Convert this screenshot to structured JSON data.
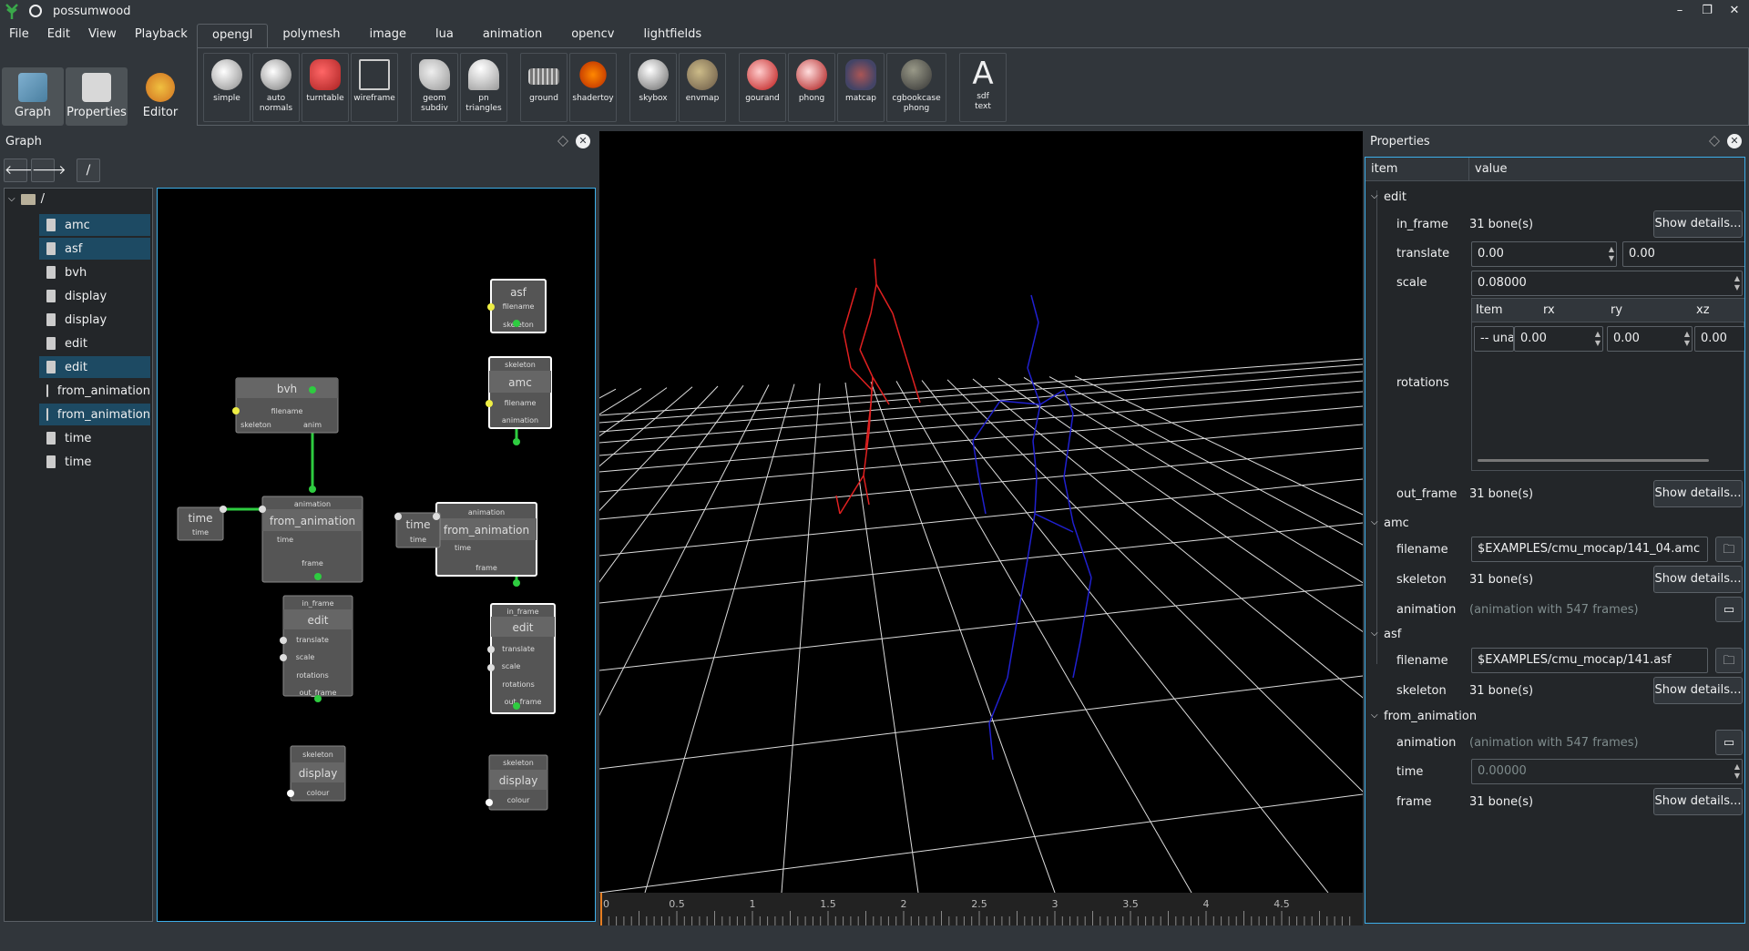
{
  "window": {
    "title": "possumwood",
    "controls": [
      "–",
      "❐",
      "✕"
    ]
  },
  "menus": [
    "File",
    "Edit",
    "View",
    "Playback"
  ],
  "modes": [
    {
      "label": "Graph",
      "active": true
    },
    {
      "label": "Properties",
      "active": true
    },
    {
      "label": "Editor",
      "active": false
    }
  ],
  "tabs": [
    "opengl",
    "polymesh",
    "image",
    "lua",
    "animation",
    "opencv",
    "lightfields"
  ],
  "active_tab": "opengl",
  "tools": [
    {
      "label": "simple",
      "icon": "teapot-icon"
    },
    {
      "label": "auto\nnormals",
      "icon": "teapot-icon"
    },
    {
      "label": "turntable",
      "icon": "car-icon"
    },
    {
      "label": "wireframe",
      "icon": "cube-wire-icon"
    },
    {
      "label": "geom\nsubdiv",
      "icon": "shape-icon"
    },
    {
      "label": "pn\ntriangles",
      "icon": "cone-icon"
    },
    {
      "label": "ground",
      "icon": "plane-icon"
    },
    {
      "label": "shadertoy",
      "icon": "swirl-icon"
    },
    {
      "label": "skybox",
      "icon": "sphere-icon"
    },
    {
      "label": "envmap",
      "icon": "teapot-gold-icon"
    },
    {
      "label": "gourand",
      "icon": "teapot-red-icon"
    },
    {
      "label": "phong",
      "icon": "teapot-red-icon"
    },
    {
      "label": "matcap",
      "icon": "figure-icon"
    },
    {
      "label": "cgbookcase\nphong",
      "icon": "sphere-dark-icon"
    },
    {
      "label": "sdf\ntext",
      "icon": "letter-a-icon"
    }
  ],
  "graph_dock": {
    "title": "Graph",
    "path": "/"
  },
  "tree": {
    "root": "/",
    "items": [
      {
        "label": "amc",
        "selected": true
      },
      {
        "label": "asf",
        "selected": true
      },
      {
        "label": "bvh",
        "selected": false
      },
      {
        "label": "display",
        "selected": false
      },
      {
        "label": "display",
        "selected": false
      },
      {
        "label": "edit",
        "selected": false
      },
      {
        "label": "edit",
        "selected": true
      },
      {
        "label": "from_animation",
        "selected": false
      },
      {
        "label": "from_animation",
        "selected": true
      },
      {
        "label": "time",
        "selected": false
      },
      {
        "label": "time",
        "selected": false
      }
    ]
  },
  "nodes": {
    "bvh": {
      "title": "bvh",
      "ports": [
        "filename",
        "skeleton",
        "anim"
      ]
    },
    "from_anim_l": {
      "title": "from_animation",
      "ports": [
        "animation",
        "time",
        "frame"
      ]
    },
    "time_l": {
      "title": "time",
      "ports": [
        "time"
      ]
    },
    "edit_l": {
      "title": "edit",
      "ports": [
        "in_frame",
        "translate",
        "scale",
        "rotations",
        "out_frame"
      ]
    },
    "display_l": {
      "title": "display",
      "ports": [
        "skeleton",
        "colour"
      ]
    },
    "asf": {
      "title": "asf",
      "ports": [
        "filename",
        "skeleton"
      ]
    },
    "amc": {
      "title": "amc",
      "ports": [
        "skeleton",
        "filename",
        "animation"
      ]
    },
    "from_anim_r": {
      "title": "from_animation",
      "ports": [
        "animation",
        "time",
        "frame"
      ]
    },
    "time_r": {
      "title": "time",
      "ports": [
        "time"
      ]
    },
    "edit_r": {
      "title": "edit",
      "ports": [
        "in_frame",
        "translate",
        "scale",
        "rotations",
        "out_frame"
      ]
    },
    "display_r": {
      "title": "display",
      "ports": [
        "skeleton",
        "colour"
      ]
    }
  },
  "timeline": {
    "ticks": [
      "0",
      "0.5",
      "1",
      "1.5",
      "2",
      "2.5",
      "3",
      "3.5",
      "4",
      "4.5"
    ]
  },
  "props": {
    "title": "Properties",
    "headers": {
      "item": "item",
      "value": "value"
    },
    "edit": {
      "group": "edit",
      "in_frame": {
        "label": "in_frame",
        "value": "31 bone(s)",
        "button": "Show details..."
      },
      "translate": {
        "label": "translate",
        "x": "0.00",
        "y": "0.00"
      },
      "scale": {
        "label": "scale",
        "value": "0.08000"
      },
      "rotations": {
        "label": "rotations",
        "cols": [
          "Item",
          "rx",
          "ry",
          "xz"
        ],
        "row": [
          "-- unass",
          "0.00",
          "0.00",
          "0.00"
        ]
      },
      "out_frame": {
        "label": "out_frame",
        "value": "31 bone(s)",
        "button": "Show details..."
      }
    },
    "amc": {
      "group": "amc",
      "filename": {
        "label": "filename",
        "value": "$EXAMPLES/cmu_mocap/141_04.amc"
      },
      "skeleton": {
        "label": "skeleton",
        "value": "31 bone(s)",
        "button": "Show details..."
      },
      "animation": {
        "label": "animation",
        "value": "(animation with 547 frames)"
      }
    },
    "asf": {
      "group": "asf",
      "filename": {
        "label": "filename",
        "value": "$EXAMPLES/cmu_mocap/141.asf"
      },
      "skeleton": {
        "label": "skeleton",
        "value": "31 bone(s)",
        "button": "Show details..."
      }
    },
    "from_animation": {
      "group": "from_animation",
      "animation": {
        "label": "animation",
        "value": "(animation with 547 frames)"
      },
      "time": {
        "label": "time",
        "value": "0.00000"
      },
      "frame": {
        "label": "frame",
        "value": "31 bone(s)",
        "button": "Show details..."
      }
    }
  },
  "colors": {
    "accent": "#3daee9",
    "selection": "#1d4a63",
    "link": "#2ecc40",
    "skeleton_a": "#e02020",
    "skeleton_b": "#2020d0"
  }
}
